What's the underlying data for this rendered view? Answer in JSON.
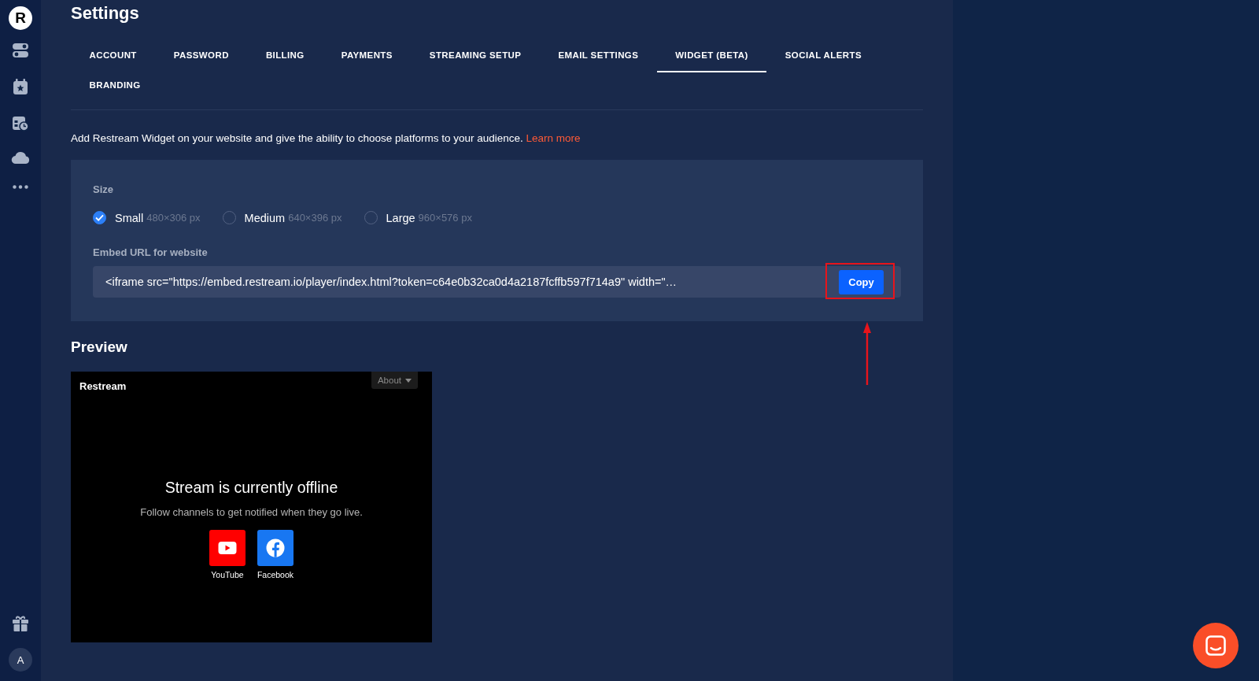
{
  "sidebar": {
    "logo": "R",
    "avatar": "A"
  },
  "page_title": "Settings",
  "tabs": [
    {
      "label": "ACCOUNT",
      "selected": false
    },
    {
      "label": "PASSWORD",
      "selected": false
    },
    {
      "label": "BILLING",
      "selected": false
    },
    {
      "label": "PAYMENTS",
      "selected": false
    },
    {
      "label": "STREAMING SETUP",
      "selected": false
    },
    {
      "label": "EMAIL SETTINGS",
      "selected": false
    },
    {
      "label": "WIDGET (BETA)",
      "selected": true
    },
    {
      "label": "SOCIAL ALERTS",
      "selected": false
    },
    {
      "label": "BRANDING",
      "selected": false
    }
  ],
  "description": {
    "text": "Add Restream Widget on your website and give the ability to choose platforms to your audience.",
    "link": "Learn more"
  },
  "size": {
    "label": "Size",
    "options": [
      {
        "name": "Small",
        "dims": "480×306 px",
        "selected": true
      },
      {
        "name": "Medium",
        "dims": "640×396 px",
        "selected": false
      },
      {
        "name": "Large",
        "dims": "960×576 px",
        "selected": false
      }
    ]
  },
  "embed": {
    "label": "Embed URL for website",
    "value": "<iframe src=\"https://embed.restream.io/player/index.html?token=c64e0b32ca0d4a2187fcffb597f714a9\" width=\"…",
    "button": "Copy"
  },
  "preview": {
    "heading": "Preview",
    "brand": "Restream",
    "menu": "About",
    "title": "Stream is currently offline",
    "subtitle": "Follow channels to get notified when they go live.",
    "channels": [
      {
        "kind": "youtube",
        "label": "YouTube"
      },
      {
        "kind": "facebook",
        "label": "Facebook"
      }
    ]
  }
}
